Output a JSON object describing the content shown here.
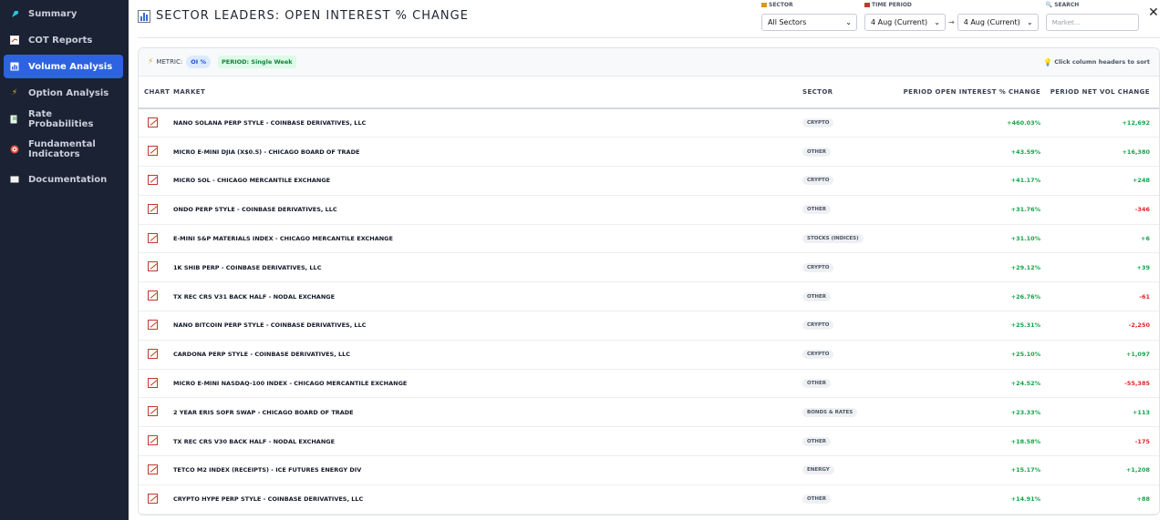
{
  "sidebar": {
    "items": [
      {
        "label": "Summary",
        "icon": "summary-icon",
        "active": false
      },
      {
        "label": "COT Reports",
        "icon": "chart-icon",
        "active": false
      },
      {
        "label": "Volume Analysis",
        "icon": "bar-chart-icon",
        "active": true
      },
      {
        "label": "Option Analysis",
        "icon": "lightning-icon",
        "active": false
      },
      {
        "label": "Rate Probabilities",
        "icon": "rate-icon",
        "active": false
      },
      {
        "label": "Fundamental Indicators",
        "icon": "target-icon",
        "active": false
      },
      {
        "label": "Documentation",
        "icon": "book-icon",
        "active": false
      }
    ]
  },
  "header": {
    "title": "SECTOR LEADERS: OPEN INTEREST % CHANGE",
    "close": "✕"
  },
  "filters": {
    "sector_label": "SECTOR",
    "sector_value": "All Sectors",
    "period_label": "TIME PERIOD",
    "period_from": "4 Aug (Current)",
    "period_to": "4 Aug (Current)",
    "period_sep": "→",
    "search_label": "SEARCH",
    "search_placeholder": "Market..."
  },
  "card": {
    "metric_label": "METRIC:",
    "metric_value": "OI %",
    "period_value": "PERIOD: Single Week",
    "sort_hint": "Click column headers to sort"
  },
  "table": {
    "headers": {
      "chart": "CHART",
      "market": "MARKET",
      "sector": "SECTOR",
      "oi_change": "PERIOD OPEN INTEREST % CHANGE",
      "net_vol": "PERIOD NET VOL CHANGE"
    },
    "rows": [
      {
        "market": "NANO SOLANA PERP STYLE - COINBASE DERIVATIVES, LLC",
        "sector": "CRYPTO",
        "oi": "+460.03%",
        "vol": "+12,692",
        "vol_sign": "pos"
      },
      {
        "market": "MICRO E-MINI DJIA (X$0.5) - CHICAGO BOARD OF TRADE",
        "sector": "OTHER",
        "oi": "+43.59%",
        "vol": "+16,380",
        "vol_sign": "pos"
      },
      {
        "market": "MICRO SOL - CHICAGO MERCANTILE EXCHANGE",
        "sector": "CRYPTO",
        "oi": "+41.17%",
        "vol": "+248",
        "vol_sign": "pos"
      },
      {
        "market": "ONDO PERP STYLE - COINBASE DERIVATIVES, LLC",
        "sector": "OTHER",
        "oi": "+31.76%",
        "vol": "-346",
        "vol_sign": "neg"
      },
      {
        "market": "E-MINI S&P MATERIALS INDEX - CHICAGO MERCANTILE EXCHANGE",
        "sector": "STOCKS (INDICES)",
        "oi": "+31.10%",
        "vol": "+6",
        "vol_sign": "pos"
      },
      {
        "market": "1K SHIB PERP - COINBASE DERIVATIVES, LLC",
        "sector": "CRYPTO",
        "oi": "+29.12%",
        "vol": "+39",
        "vol_sign": "pos"
      },
      {
        "market": "TX REC CRS V31 BACK HALF - NODAL EXCHANGE",
        "sector": "OTHER",
        "oi": "+26.76%",
        "vol": "-61",
        "vol_sign": "neg"
      },
      {
        "market": "NANO BITCOIN PERP STYLE - COINBASE DERIVATIVES, LLC",
        "sector": "CRYPTO",
        "oi": "+25.31%",
        "vol": "-2,250",
        "vol_sign": "neg"
      },
      {
        "market": "CARDONA PERP STYLE - COINBASE DERIVATIVES, LLC",
        "sector": "CRYPTO",
        "oi": "+25.10%",
        "vol": "+1,097",
        "vol_sign": "pos"
      },
      {
        "market": "MICRO E-MINI NASDAQ-100 INDEX - CHICAGO MERCANTILE EXCHANGE",
        "sector": "OTHER",
        "oi": "+24.52%",
        "vol": "-55,385",
        "vol_sign": "neg"
      },
      {
        "market": "2 YEAR ERIS SOFR SWAP - CHICAGO BOARD OF TRADE",
        "sector": "BONDS & RATES",
        "oi": "+23.33%",
        "vol": "+113",
        "vol_sign": "pos"
      },
      {
        "market": "TX REC CRS V30 BACK HALF - NODAL EXCHANGE",
        "sector": "OTHER",
        "oi": "+18.58%",
        "vol": "-175",
        "vol_sign": "neg"
      },
      {
        "market": "TETCO M2 INDEX (RECEIPTS) - ICE FUTURES ENERGY DIV",
        "sector": "ENERGY",
        "oi": "+15.17%",
        "vol": "+1,208",
        "vol_sign": "pos"
      },
      {
        "market": "CRYPTO HYPE PERP STYLE - COINBASE DERIVATIVES, LLC",
        "sector": "OTHER",
        "oi": "+14.91%",
        "vol": "+88",
        "vol_sign": "pos"
      }
    ]
  },
  "colors": {
    "sidebar_bg": "#1b2233",
    "active_nav": "#2d63e0",
    "positive": "#16a34a",
    "negative": "#dc2626"
  }
}
